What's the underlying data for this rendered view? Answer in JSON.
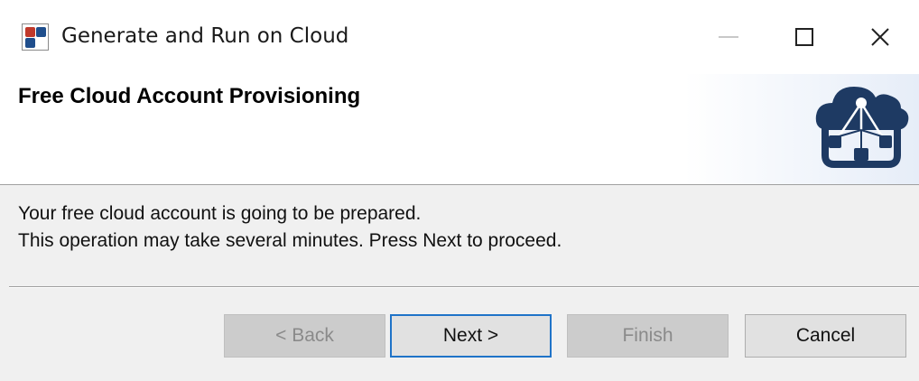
{
  "window": {
    "title": "Generate and Run on Cloud",
    "controls": {
      "minimize": "minimize-icon",
      "maximize": "maximize-icon",
      "close": "close-icon"
    }
  },
  "header": {
    "title": "Free Cloud Account Provisioning",
    "logo_icon": "cloud-network-icon"
  },
  "body": {
    "line1": "Your free cloud account is going to be prepared.",
    "line2": "This operation may take several minutes. Press Next to proceed."
  },
  "buttons": {
    "back": {
      "label": "< Back",
      "enabled": false
    },
    "next": {
      "label": "Next >",
      "enabled": true,
      "focused": true
    },
    "finish": {
      "label": "Finish",
      "enabled": false
    },
    "cancel": {
      "label": "Cancel",
      "enabled": true
    }
  },
  "colors": {
    "accent": "#1f73c8",
    "logo": "#1e3a63",
    "disabled_button": "#cccccc"
  }
}
